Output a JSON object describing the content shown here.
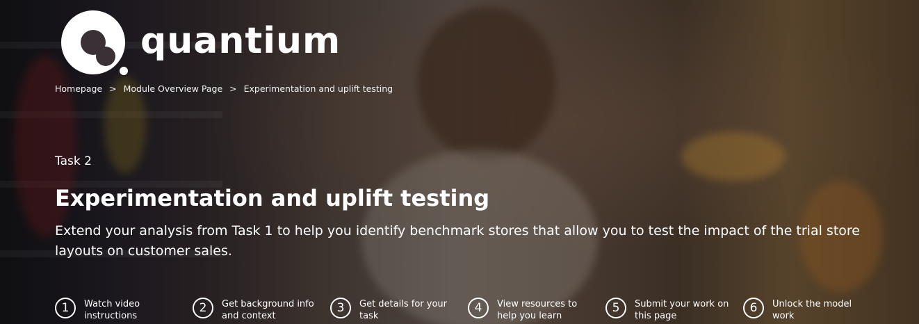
{
  "brand": {
    "name": "quantium",
    "logo_icon": "quantium-logo-mark"
  },
  "breadcrumb": [
    {
      "label": "Homepage"
    },
    {
      "label": "Module Overview Page"
    },
    {
      "label": "Experimentation and uplift testing"
    }
  ],
  "breadcrumb_separator": ">",
  "hero": {
    "task_label": "Task 2",
    "title": "Experimentation and uplift testing",
    "description": "Extend your analysis from Task 1 to help you identify benchmark stores that allow you to test the impact of the trial store layouts on customer sales."
  },
  "steps": [
    {
      "number": "1",
      "label": "Watch video instructions"
    },
    {
      "number": "2",
      "label": "Get background info and context"
    },
    {
      "number": "3",
      "label": "Get details for your task"
    },
    {
      "number": "4",
      "label": "View resources to help you learn"
    },
    {
      "number": "5",
      "label": "Submit your work on this page"
    },
    {
      "number": "6",
      "label": "Unlock the model work"
    }
  ]
}
